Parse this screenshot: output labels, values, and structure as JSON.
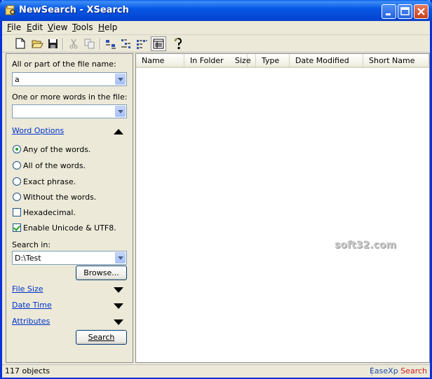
{
  "window": {
    "title": "NewSearch - XSearch",
    "accent": "#0054e3",
    "close_color": "#d5461f"
  },
  "menu": {
    "items": [
      {
        "label": "File",
        "key": "F",
        "rest": "ile"
      },
      {
        "label": "Edit",
        "key": "E",
        "rest": "dit"
      },
      {
        "label": "View",
        "key": "V",
        "rest": "iew"
      },
      {
        "label": "Tools",
        "key": "T",
        "rest": "ools"
      },
      {
        "label": "Help",
        "key": "H",
        "rest": "elp"
      }
    ]
  },
  "toolbar": {
    "icons": [
      "new-file-icon",
      "open-folder-icon",
      "save-icon",
      "cut-icon",
      "copy-icon",
      "large-icons-view-icon",
      "small-icons-view-icon",
      "list-view-icon",
      "details-view-icon",
      "help-icon"
    ]
  },
  "search": {
    "filename_label": "All or part of the file name:",
    "filename_value": "a",
    "words_label": "One or more words in the file:",
    "words_value": "",
    "word_options_label": "Word Options",
    "options": [
      {
        "label": "Any of the words.",
        "checked": true
      },
      {
        "label": "All of the words.",
        "checked": false
      },
      {
        "label": "Exact phrase.",
        "checked": false
      },
      {
        "label": "Without the words.",
        "checked": false
      }
    ],
    "hexadecimal_label": "Hexadecimal.",
    "hexadecimal_checked": false,
    "unicode_label": "Enable Unicode & UTF8.",
    "unicode_checked": true,
    "search_in_label": "Search in:",
    "search_in_value": "D:\\Test",
    "browse_label": "Browse...",
    "file_size_label": "File Size",
    "date_time_label": "Date Time",
    "attributes_label": "Attributes",
    "search_button_label": "Search"
  },
  "results": {
    "columns": [
      "Name",
      "In Folder",
      "Size",
      "Type",
      "Date Modified",
      "Short Name"
    ],
    "rows": []
  },
  "watermark": "soft32.com",
  "status": {
    "count_text": "117 objects",
    "brand_part1": "EaseXp",
    "brand_part2": "Search",
    "brand_color_1": "#1f4fa8",
    "brand_color_2": "#d01e1e"
  }
}
